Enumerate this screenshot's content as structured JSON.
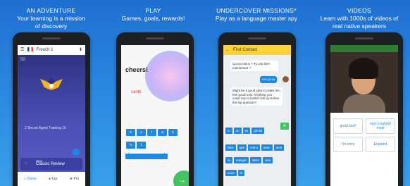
{
  "panels": [
    {
      "heading": "AN ADVENTURE",
      "sub": "Your learning is a mission of discovery"
    },
    {
      "heading": "PLAY",
      "sub": "Games, goals, rewards!"
    },
    {
      "heading": "UNDERCOVER MISSIONS*",
      "sub": "Play as a language master spy"
    },
    {
      "heading": "VIDEOS",
      "sub": "Learn with 1000s of videos of real native speakers"
    }
  ],
  "screen1": {
    "language": "French 1",
    "level": "50",
    "mission": "2 Secret Agent Training 10",
    "review_label": "Classic Review",
    "review_kicker": "NEW",
    "nav": [
      "Home",
      "Tap",
      "Pro"
    ]
  },
  "screen2": {
    "prompt": "cheers!",
    "answer": "santé",
    "keys_row1": [
      "é",
      "s",
      "t",
      "a",
      "n"
    ],
    "keys_row2": [
      "n",
      "t"
    ]
  },
  "screen3": {
    "title": "First Contact",
    "msg1": "Ça va mieux ? Tu vas bien maintenant ?",
    "reply": "oui ça va",
    "msg2": "Might be a good idea to make him feel good now. Anything you could say to further link up before the big question?",
    "chips_row1": [
      "tu",
      "vu",
      "es",
      "génial"
    ],
    "chips_row2": [
      "bien",
      "que",
      "merci",
      "avec",
      "mon"
    ],
    "chips_row3": [
      "ta",
      "manger",
      "alors",
      "mes"
    ],
    "chips_row4": [
      "vous",
      "et"
    ]
  },
  "screen4": {
    "answers": [
      "good luck!",
      "nice (cooked) meal",
      "I'm sorry",
      "England"
    ]
  },
  "colors": {
    "bg_top": "#1f6fd1",
    "accent": "#1e88e5",
    "chat_bar": "#ffd23a",
    "video_bar": "#2e7d32"
  }
}
